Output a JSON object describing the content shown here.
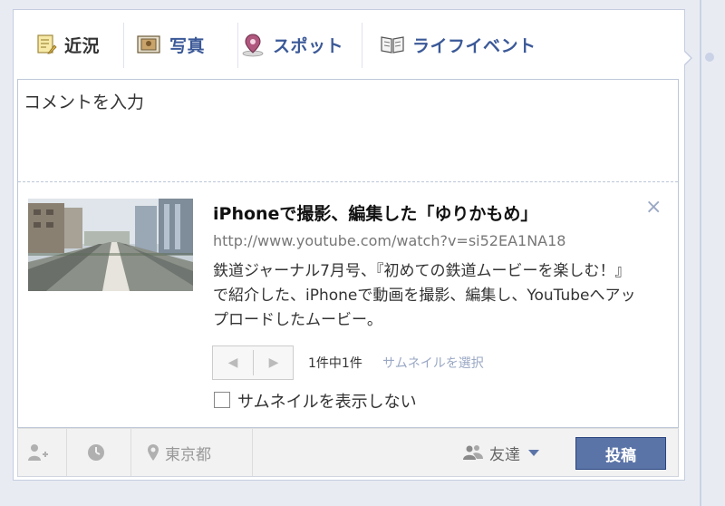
{
  "tabs": [
    {
      "label": "近況",
      "icon": "status-icon",
      "active": true
    },
    {
      "label": "写真",
      "icon": "photo-icon",
      "active": false
    },
    {
      "label": "スポット",
      "icon": "place-pin-icon",
      "active": false
    },
    {
      "label": "ライフイベント",
      "icon": "life-event-book-icon",
      "active": false
    }
  ],
  "composer": {
    "comment_text": "コメントを入力"
  },
  "link_preview": {
    "title": "iPhoneで撮影、編集した「ゆりかもめ」",
    "url": "http://www.youtube.com/watch?v=si52EA1NA18",
    "description": "鉄道ジャーナル7月号、『初めての鉄道ムービーを楽しむ！』で紹介した、iPhoneで動画を撮影、編集し、YouTubeへアップロードしたムービー。",
    "close_label": "×",
    "thumb_count": "1件中1件",
    "choose_thumb": "サムネイルを選択",
    "no_thumb_label": "サムネイルを表示しない"
  },
  "footer": {
    "location": "東京都",
    "audience": "友達",
    "post_label": "投稿"
  },
  "colors": {
    "accent": "#3b5998",
    "post_button": "#5b74a8",
    "background": "#e9ebf3"
  }
}
